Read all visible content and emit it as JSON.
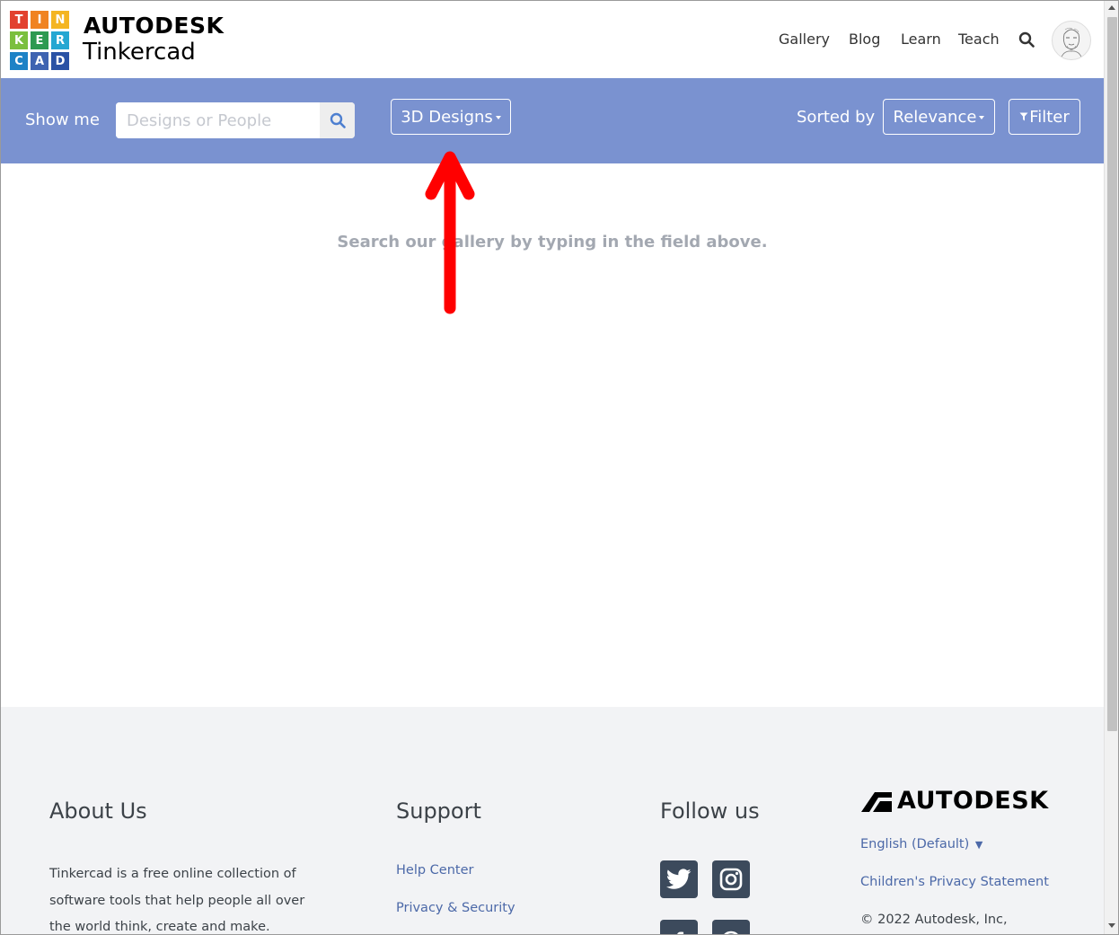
{
  "header": {
    "logo_letters": [
      "T",
      "I",
      "N",
      "K",
      "E",
      "R",
      "C",
      "A",
      "D"
    ],
    "logo_colors": [
      "#e2412f",
      "#f08321",
      "#f4b522",
      "#7bbf3e",
      "#2d9a51",
      "#25a7d2",
      "#1d82c6",
      "#3e63b1",
      "#2a52a5"
    ],
    "brand_line1": "AUTODESK",
    "brand_line2": "Tinkercad",
    "nav": {
      "gallery": "Gallery",
      "blog": "Blog",
      "learn": "Learn",
      "teach": "Teach"
    },
    "search_icon": "search-icon",
    "avatar_icon": "user-avatar-sketch"
  },
  "searchbar": {
    "bg_color": "#7a92d0",
    "show_me_label": "Show me",
    "placeholder": "Designs or People",
    "value": "",
    "type_button": "3D Designs",
    "sorted_by_label": "Sorted by",
    "sort_button": "Relevance",
    "filter_button": "Filter"
  },
  "content": {
    "empty_message": "Search our gallery by typing in the field above."
  },
  "annotation": {
    "type": "red-arrow",
    "color": "#ff0000",
    "points_to": "type_button"
  },
  "footer": {
    "about_heading": "About Us",
    "about_text": "Tinkercad is a free online collection of software tools that help people all over the world think, create and make. We're",
    "support_heading": "Support",
    "support_links": [
      "Help Center",
      "Privacy & Security"
    ],
    "follow_heading": "Follow us",
    "social_icons": [
      "twitter-icon",
      "instagram-icon",
      "facebook-icon",
      "pinterest-icon"
    ],
    "autodesk_logo": "AUTODESK",
    "language": "English (Default)",
    "children_privacy": "Children's Privacy Statement",
    "copyright": "© 2022 Autodesk, Inc,"
  }
}
